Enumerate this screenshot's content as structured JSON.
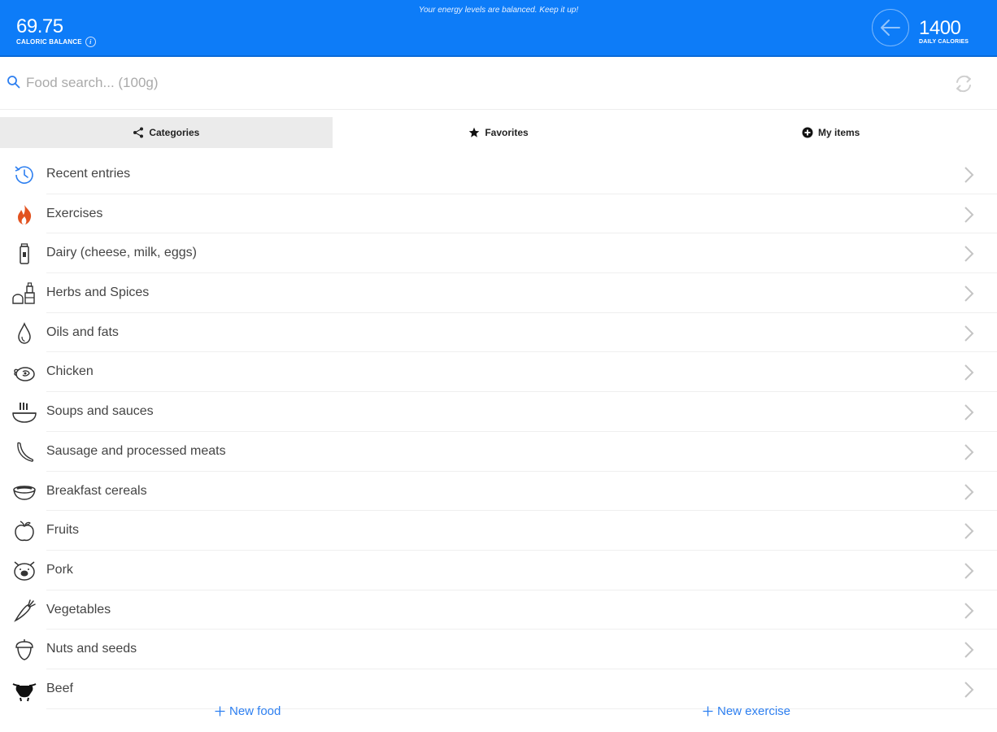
{
  "header": {
    "message": "Your energy levels are balanced. Keep it up!",
    "caloric_balance_value": "69.75",
    "caloric_balance_label": "CALORIC BALANCE",
    "daily_calories_value": "1400",
    "daily_calories_label": "DAILY CALORIES",
    "accent_color": "#0d7cf8"
  },
  "search": {
    "placeholder": "Food search... (100g)",
    "value": ""
  },
  "tabs": [
    {
      "label": "Categories",
      "icon": "share-icon",
      "active": true
    },
    {
      "label": "Favorites",
      "icon": "star-icon",
      "active": false
    },
    {
      "label": "My items",
      "icon": "plus-circle-icon",
      "active": false
    }
  ],
  "categories": [
    {
      "label": "Recent entries",
      "icon": "clock-icon"
    },
    {
      "label": "Exercises",
      "icon": "flame-icon"
    },
    {
      "label": "Dairy (cheese, milk, eggs)",
      "icon": "milk-carton-icon"
    },
    {
      "label": "Herbs and Spices",
      "icon": "spice-jars-icon"
    },
    {
      "label": "Oils and fats",
      "icon": "oil-drop-icon"
    },
    {
      "label": "Chicken",
      "icon": "chicken-icon"
    },
    {
      "label": "Soups and sauces",
      "icon": "soup-bowl-icon"
    },
    {
      "label": "Sausage and processed meats",
      "icon": "sausage-icon"
    },
    {
      "label": "Breakfast cereals",
      "icon": "cereal-bowl-icon"
    },
    {
      "label": "Fruits",
      "icon": "apple-icon"
    },
    {
      "label": "Pork",
      "icon": "pig-icon"
    },
    {
      "label": "Vegetables",
      "icon": "carrot-icon"
    },
    {
      "label": "Nuts and seeds",
      "icon": "acorn-icon"
    },
    {
      "label": "Beef",
      "icon": "cow-icon"
    }
  ],
  "actions": {
    "new_food": "New food",
    "new_exercise": "New exercise",
    "color": "#2d7ff0"
  }
}
